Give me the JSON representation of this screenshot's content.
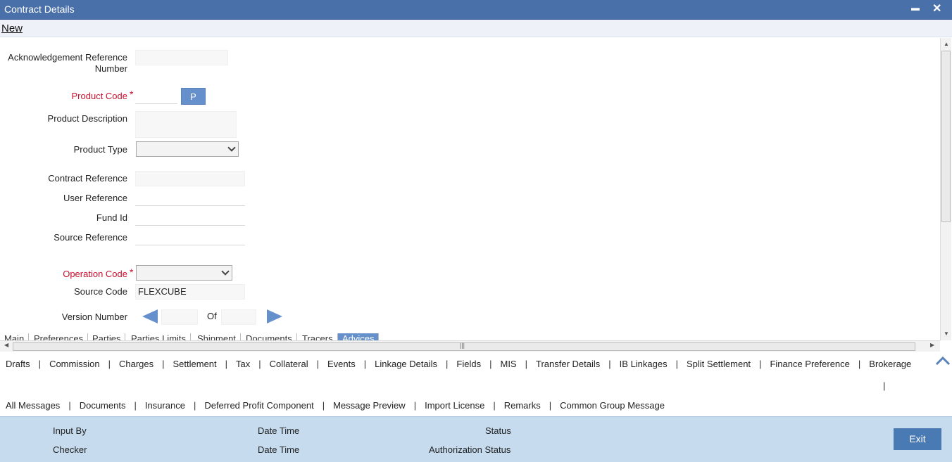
{
  "window": {
    "title": "Contract Details",
    "minimize_glyph": "▬",
    "close_glyph": "✕"
  },
  "toolbar": {
    "new_label": "New"
  },
  "form": {
    "ack_ref_label_line1": "Acknowledgement Reference",
    "ack_ref_label_line2": "Number",
    "ack_ref_value": "",
    "product_code_label": "Product Code",
    "required_mark": "*",
    "product_code_value": "",
    "p_button_label": "P",
    "product_description_label": "Product Description",
    "product_description_value": "",
    "product_type_label": "Product Type",
    "product_type_value": "",
    "contract_reference_label": "Contract Reference",
    "contract_reference_value": "",
    "user_reference_label": "User Reference",
    "user_reference_value": "",
    "fund_id_label": "Fund Id",
    "fund_id_value": "",
    "source_reference_label": "Source Reference",
    "source_reference_value": "",
    "operation_code_label": "Operation Code",
    "operation_code_value": "",
    "source_code_label": "Source Code",
    "source_code_value": "FLEXCUBE",
    "version_number_label": "Version Number",
    "version_current": "",
    "version_of_label": "Of",
    "version_total": ""
  },
  "tabs": [
    {
      "label": "Main"
    },
    {
      "label": "Preferences"
    },
    {
      "label": "Parties"
    },
    {
      "label": "Parties Limits"
    },
    {
      "label": "Shipment"
    },
    {
      "label": "Documents"
    },
    {
      "label": "Tracers"
    },
    {
      "label": "Advices",
      "active": true
    }
  ],
  "links_row1": [
    "Drafts",
    "Commission",
    "Charges",
    "Settlement",
    "Tax",
    "Collateral",
    "Events",
    "Linkage Details",
    "Fields",
    "MIS",
    "Transfer Details",
    "IB Linkages",
    "Split Settlement",
    "Finance Preference",
    "Brokerage"
  ],
  "links_row1_trailing_sep": "|",
  "links_row2": [
    "All Messages",
    "Documents",
    "Insurance",
    "Deferred Profit Component",
    "Message Preview",
    "Import License",
    "Remarks",
    "Common Group Message"
  ],
  "footer": {
    "input_by_label": "Input By",
    "date_time_label_1": "Date Time",
    "status_label": "Status",
    "checker_label": "Checker",
    "date_time_label_2": "Date Time",
    "authorization_status_label": "Authorization Status",
    "exit_label": "Exit"
  },
  "icons": {
    "scroll_up": "▲",
    "scroll_down": "▼",
    "scroll_left": "◀",
    "scroll_right": "▶",
    "grip": "|||"
  },
  "colors": {
    "titlebar": "#4a70aa",
    "accent": "#6590cb",
    "required": "#c8102e",
    "footer": "#c6dbee"
  }
}
